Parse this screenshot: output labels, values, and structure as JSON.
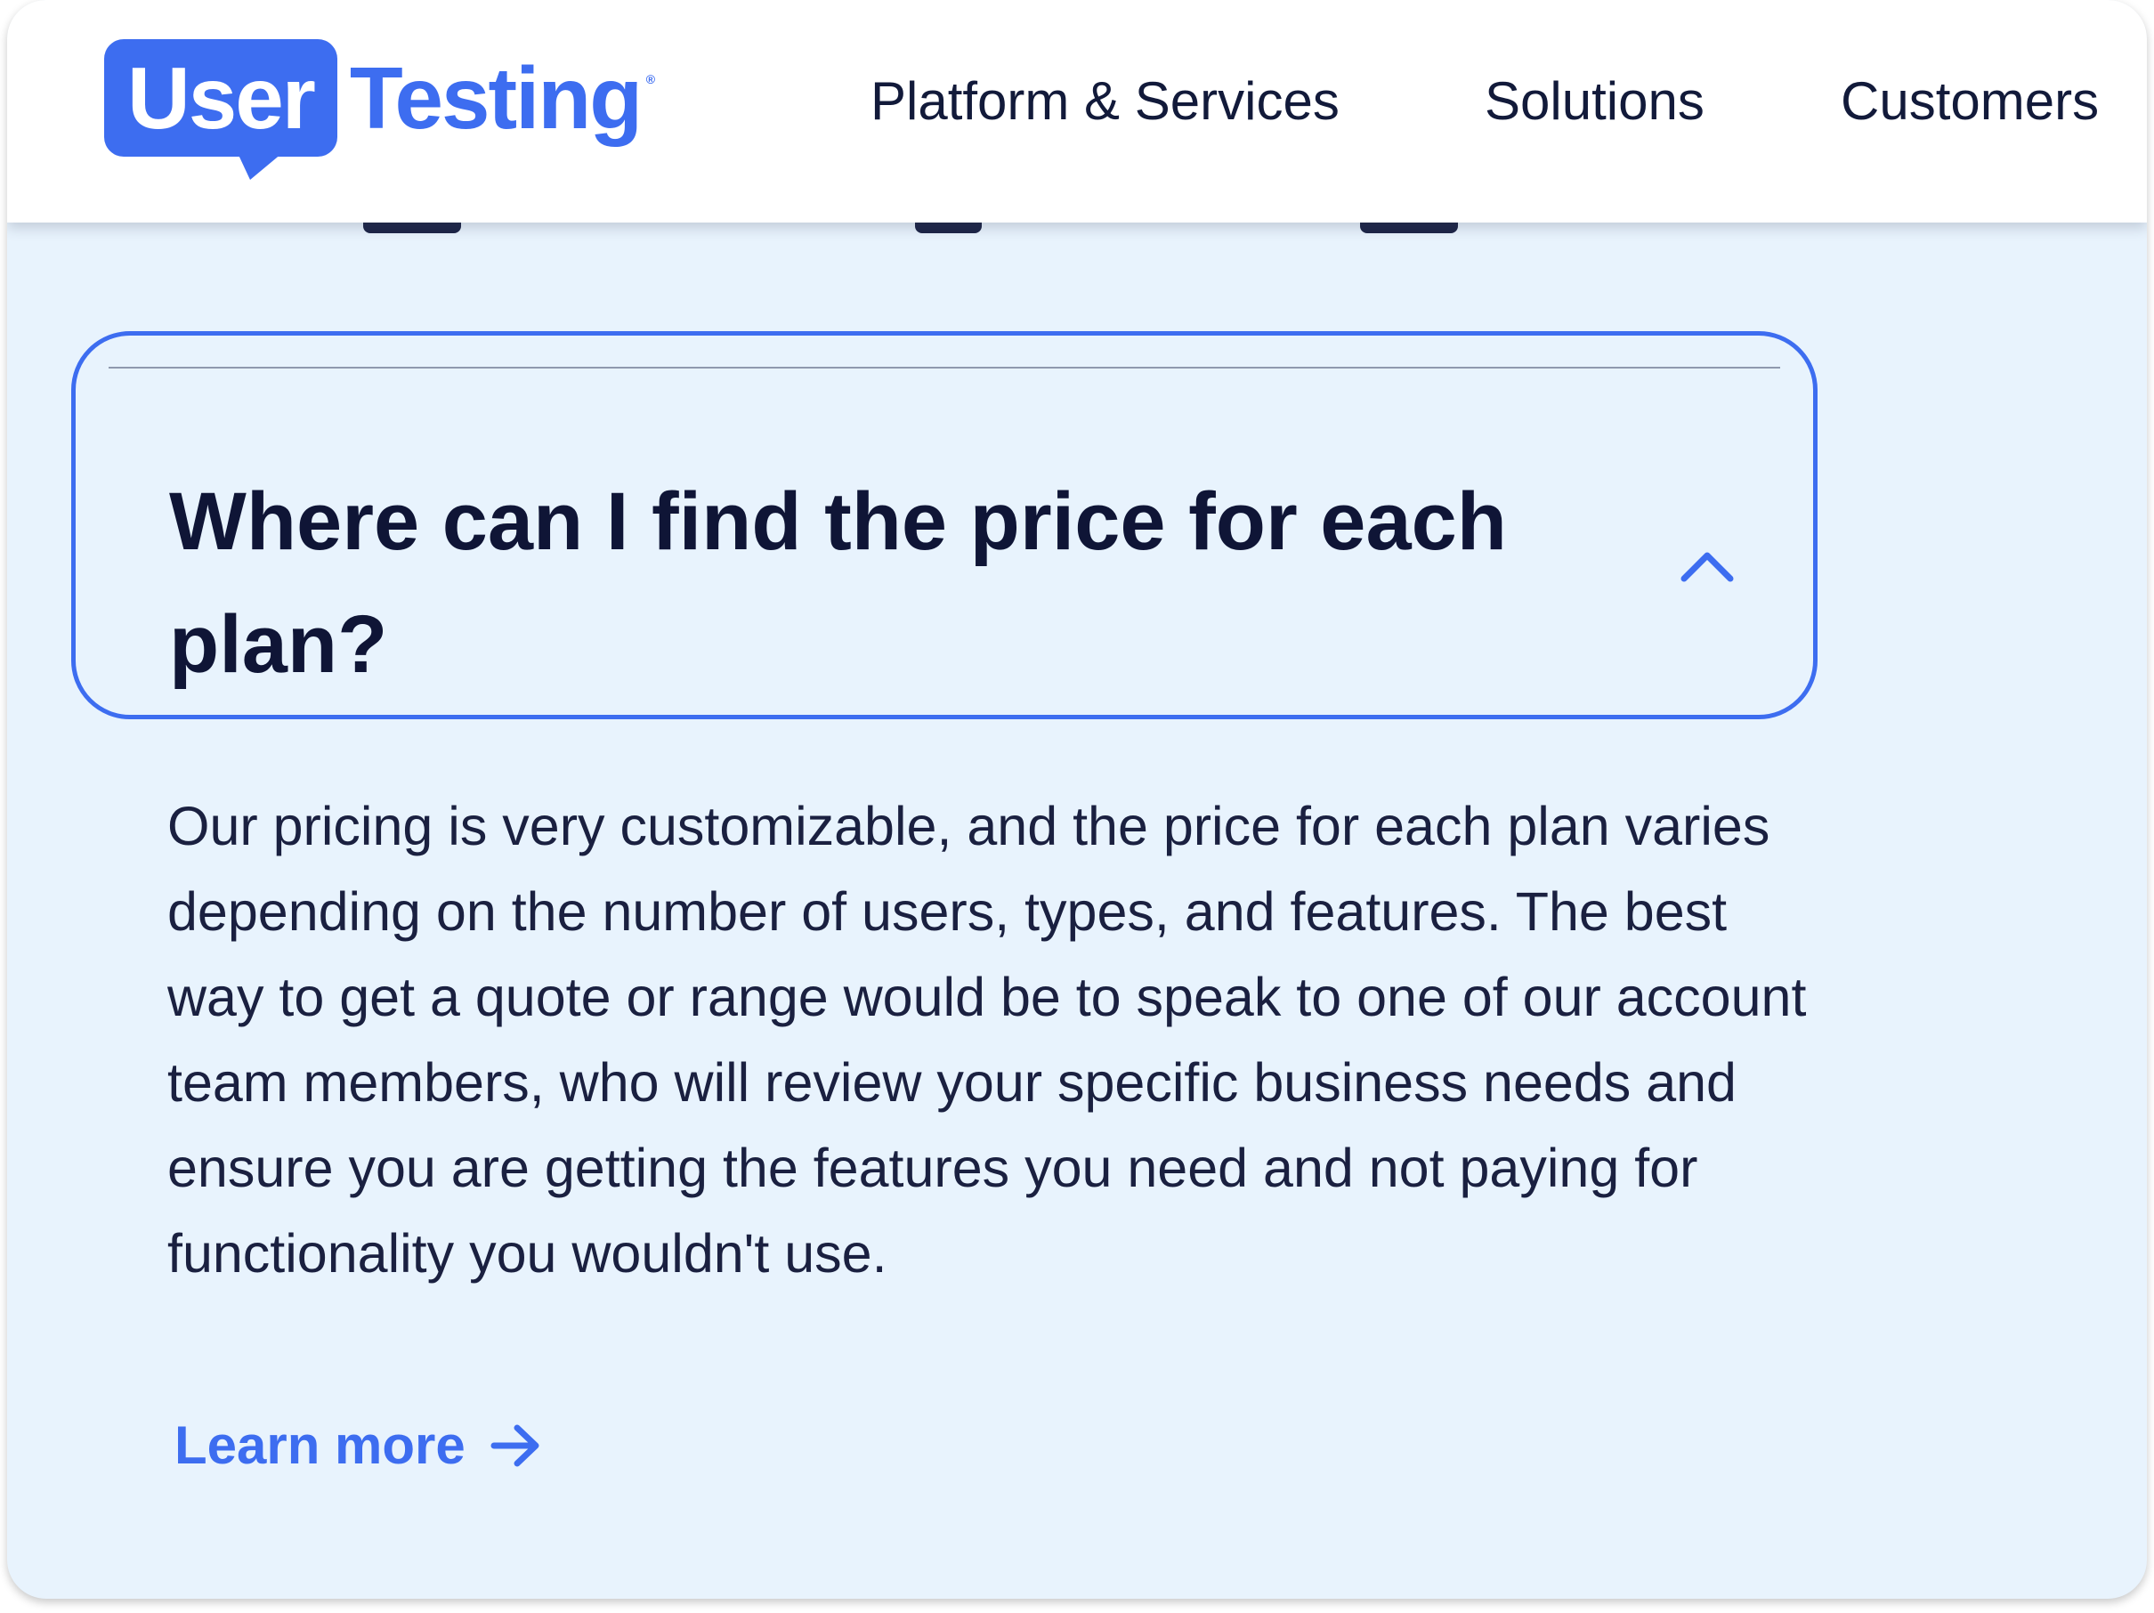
{
  "header": {
    "logo": {
      "user_text": "User",
      "testing_text": "Testing",
      "registered_mark": "®"
    },
    "nav": [
      {
        "label": "Platform & Services"
      },
      {
        "label": "Solutions"
      },
      {
        "label": "Customers"
      }
    ]
  },
  "faq": {
    "question": "Where can I find the price for each plan?",
    "expanded": true,
    "toggle_icon": "chevron-up-icon",
    "answer": "Our pricing is very customizable, and the price for each plan varies depending on the number of users, types, and features. The best way to get a quote or range would be to speak to one of our account team members, who will review your specific business needs and ensure you are getting the features you need and not paying for functionality you wouldn't use.",
    "learn_more_label": "Learn more",
    "learn_more_icon": "arrow-right-icon"
  },
  "colors": {
    "brand_blue": "#3d6df0",
    "background": "#e8f3fd",
    "text_dark": "#0f1536"
  }
}
